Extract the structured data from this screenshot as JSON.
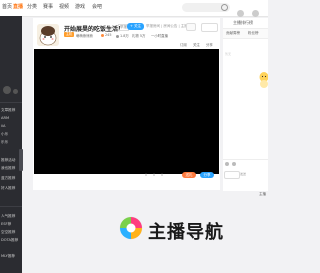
{
  "nav": {
    "items": [
      {
        "label": "首页",
        "active": false
      },
      {
        "label": "直播",
        "active": true
      },
      {
        "label": "分类",
        "active": false
      },
      {
        "label": "赛事",
        "active": false
      },
      {
        "label": "视频",
        "active": false
      },
      {
        "label": "游戏",
        "active": false
      },
      {
        "label": "会吧",
        "active": false
      }
    ],
    "search_placeholder": ""
  },
  "sidebar": {
    "items": [
      "文章推荐",
      "ARM",
      "iiA",
      "小乐",
      "乐乐",
      "推荐活动",
      "我也推荐",
      "蓝方推荐",
      "好人推荐",
      "人气推荐",
      "ESF荐",
      "空空推荐",
      "DOTA推荐",
      "MLY推荐"
    ]
  },
  "room": {
    "title": "开始展昊的吃饭生活！",
    "title_tag": "举报",
    "follow_label": "+ 关注",
    "report_text": "举报房间 | 房间公告 | 主播",
    "category_badge": "主机",
    "meta_name": "萌萌熊熊熊",
    "meta_count_1": "245",
    "meta_count_2": "1.8万",
    "meta_extra": "礼物 5万",
    "meta_live": "一小时直播",
    "small_links": [
      "订阅",
      "关注",
      "分享"
    ],
    "bottom_stats": [
      "0",
      "0",
      "0"
    ],
    "btn_orange": "送礼",
    "btn_blue": "分享"
  },
  "right_panel": {
    "header": "主播排行榜",
    "tabs": [
      "贡献周榜",
      "粉丝榜"
    ],
    "empty_label": "暂无",
    "chat_button": "发送"
  },
  "watermark": {
    "text": "主播导航"
  },
  "side_note": "主播"
}
